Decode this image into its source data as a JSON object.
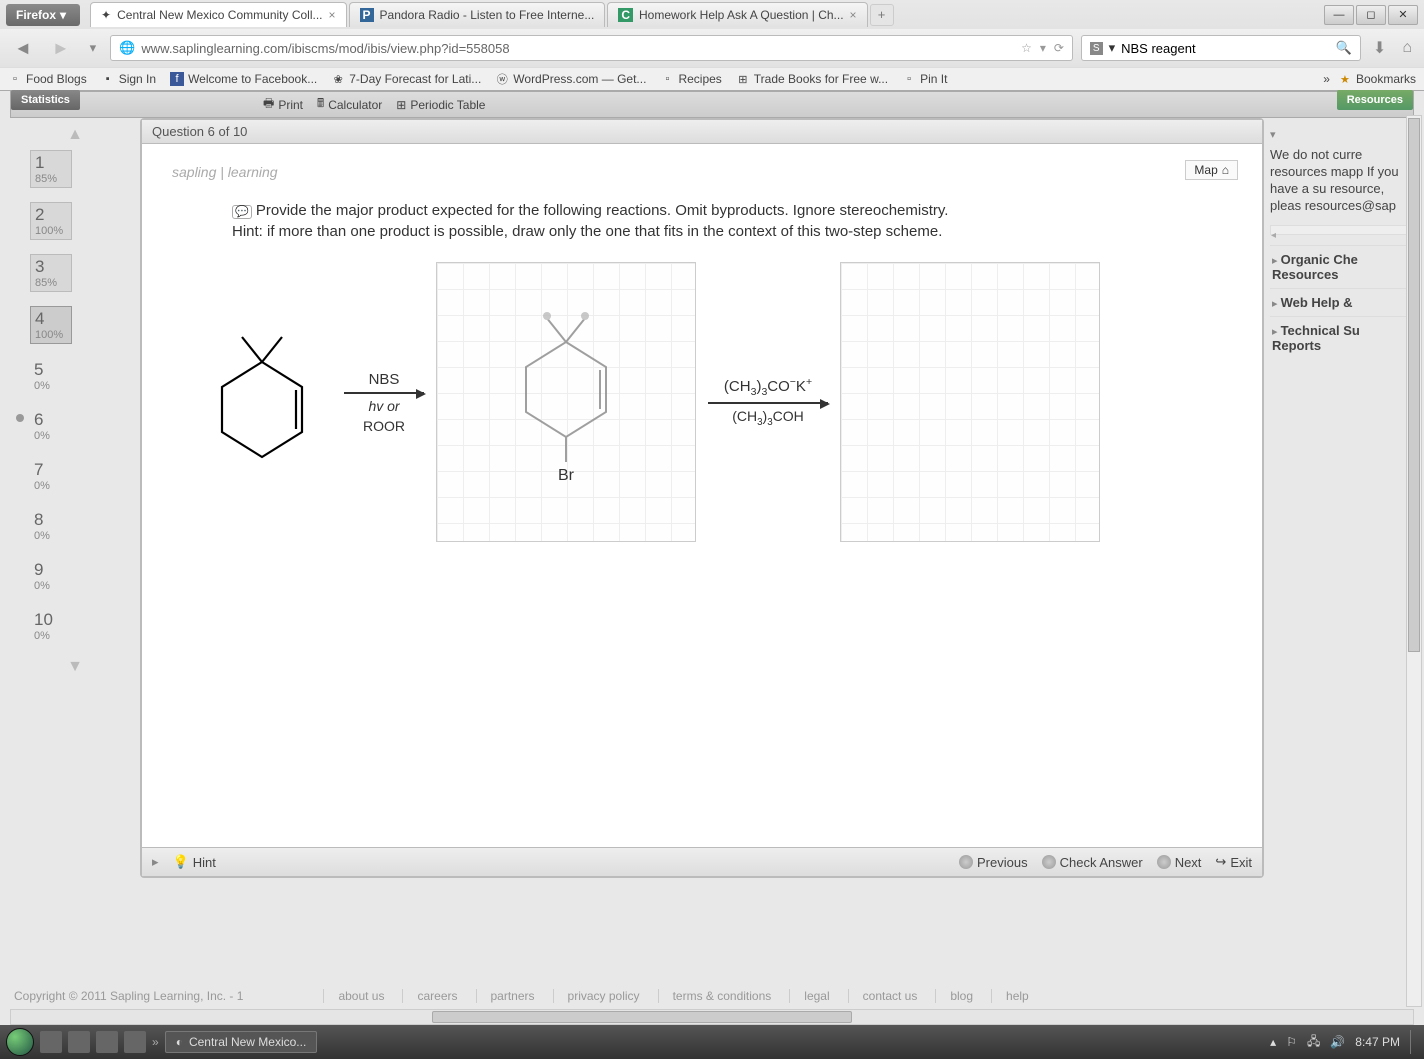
{
  "browser": {
    "name": "Firefox",
    "tabs": [
      {
        "title": "Central New Mexico Community Coll...",
        "active": true
      },
      {
        "title": "Pandora Radio - Listen to Free Interne...",
        "icon": "P"
      },
      {
        "title": "Homework Help Ask A Question | Ch...",
        "icon": "C"
      }
    ],
    "url": "www.saplinglearning.com/ibiscms/mod/ibis/view.php?id=558058",
    "search_value": "NBS reagent",
    "bookmarks": [
      "Food Blogs",
      "Sign In",
      "Welcome to Facebook...",
      "7-Day Forecast for Lati...",
      "WordPress.com — Get...",
      "Recipes",
      "Trade Books for Free w...",
      "Pin It"
    ],
    "bookmarks_more": "Bookmarks"
  },
  "app": {
    "toolbar": {
      "statistics": "Statistics",
      "print": "Print",
      "calculator": "Calculator",
      "periodic": "Periodic Table",
      "resources": "Resources"
    }
  },
  "questions": {
    "header": "Question 6 of 10",
    "items": [
      {
        "num": "1",
        "pct": "85%",
        "state": "filled"
      },
      {
        "num": "2",
        "pct": "100%",
        "state": "filled"
      },
      {
        "num": "3",
        "pct": "85%",
        "state": "filled"
      },
      {
        "num": "4",
        "pct": "100%",
        "state": "selected"
      },
      {
        "num": "5",
        "pct": "0%",
        "state": ""
      },
      {
        "num": "6",
        "pct": "0%",
        "state": "current"
      },
      {
        "num": "7",
        "pct": "0%",
        "state": ""
      },
      {
        "num": "8",
        "pct": "0%",
        "state": ""
      },
      {
        "num": "9",
        "pct": "0%",
        "state": ""
      },
      {
        "num": "10",
        "pct": "0%",
        "state": ""
      }
    ]
  },
  "question": {
    "logo": "sapling | learning",
    "map_btn": "Map",
    "prompt_line1": "Provide the major product expected for the following reactions. Omit byproducts. Ignore stereochemistry.",
    "prompt_line2": "Hint: if more than one product is possible, draw only the one that fits in the context of this two-step scheme.",
    "reagent1_top": "NBS",
    "reagent1_bottom1": "hv or",
    "reagent1_bottom2": "ROOR",
    "intermediate_label": "Br",
    "reagent2_top": "(CH₃)₃CO⁻K⁺",
    "reagent2_bottom": "(CH₃)₃COH",
    "footer": {
      "hint": "Hint",
      "previous": "Previous",
      "check": "Check Answer",
      "next": "Next",
      "exit": "Exit"
    }
  },
  "resources": {
    "text": "We do not currently have any resources mapped to this question. If you have a suggestion for a resource, please email us: resources@saplinglearning.com",
    "text_short": "We do not curre resources mapp If you have a su resource, pleas resources@sap",
    "items": [
      "Organic Chemistry Resources",
      "Web Help & Support",
      "Technical Support Reports"
    ],
    "items_short": [
      {
        "l1": "Organic Che",
        "l2": "Resources"
      },
      {
        "l1": "Web Help &",
        "l2": ""
      },
      {
        "l1": "Technical Su",
        "l2": "Reports"
      }
    ]
  },
  "footer": {
    "copyright": "Copyright © 2011 Sapling Learning, Inc. - 1",
    "links": [
      "about us",
      "careers",
      "partners",
      "privacy policy",
      "terms & conditions",
      "legal",
      "contact us",
      "blog",
      "help"
    ]
  },
  "taskbar": {
    "active_window": "Central New Mexico...",
    "time": "8:47 PM"
  }
}
